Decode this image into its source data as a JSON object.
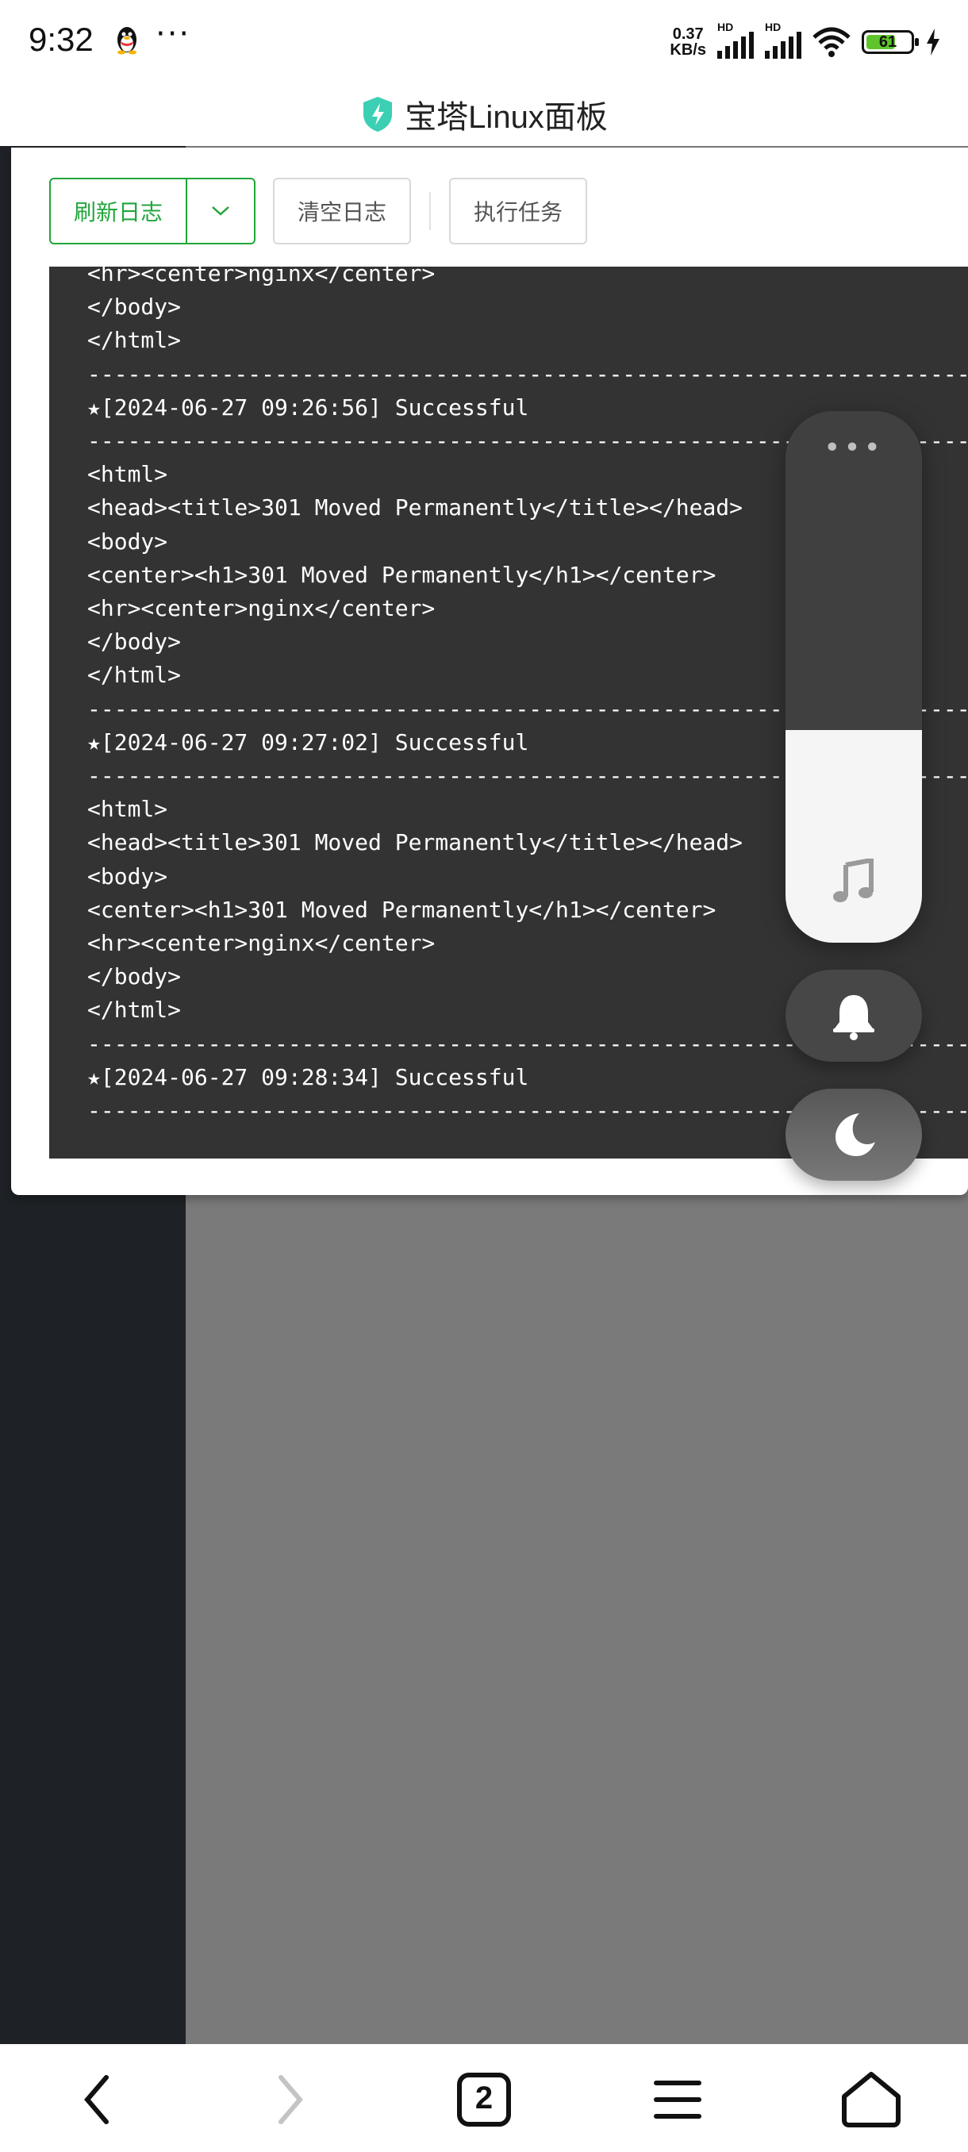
{
  "status_bar": {
    "time": "9:32",
    "net_speed_value": "0.37",
    "net_speed_unit": "KB/s",
    "hd1": "HD",
    "hd2": "HD",
    "battery": "61"
  },
  "app": {
    "title": "宝塔Linux面板",
    "brand_color": "#20a53a"
  },
  "toolbar": {
    "refresh_label": "刷新日志",
    "clear_label": "清空日志",
    "run_label": "执行任务"
  },
  "log": {
    "text": "<hr><center>nginx</center>\n</body>\n</html>\n---------------------------------------------------------------------\n★[2024-06-27 09:26:56] Successful\n---------------------------------------------------------------------\n<html>\n<head><title>301 Moved Permanently</title></head>\n<body>\n<center><h1>301 Moved Permanently</h1></center>\n<hr><center>nginx</center>\n</body>\n</html>\n---------------------------------------------------------------------\n★[2024-06-27 09:27:02] Successful\n---------------------------------------------------------------------\n<html>\n<head><title>301 Moved Permanently</title></head>\n<body>\n<center><h1>301 Moved Permanently</h1></center>\n<hr><center>nginx</center>\n</body>\n</html>\n---------------------------------------------------------------------\n★[2024-06-27 09:28:34] Successful\n---------------------------------------------------------------------"
  },
  "nav": {
    "tab_count": "2"
  }
}
